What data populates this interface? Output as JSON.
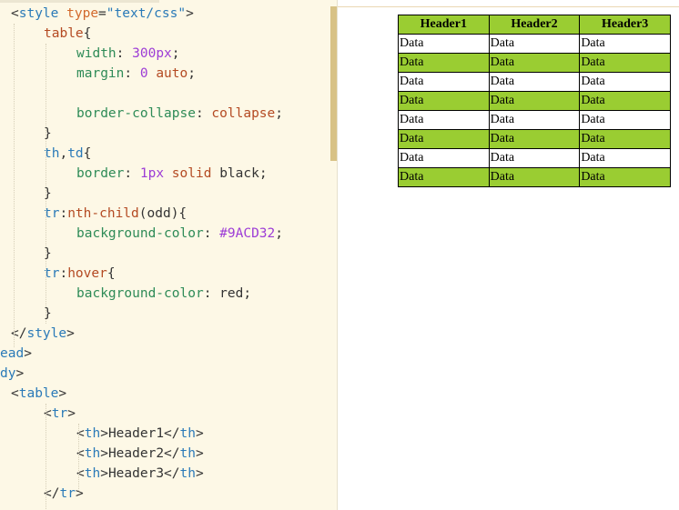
{
  "editor": {
    "lines": [
      [
        {
          "c": "t-punc",
          "t": "<"
        },
        {
          "c": "t-tag",
          "t": "style"
        },
        {
          "c": "t-punc",
          "t": " "
        },
        {
          "c": "t-attr",
          "t": "type"
        },
        {
          "c": "t-punc",
          "t": "="
        },
        {
          "c": "t-str",
          "t": "\"text/css\""
        },
        {
          "c": "t-punc",
          "t": ">"
        }
      ],
      [
        {
          "c": "t-sel",
          "t": "table"
        },
        {
          "c": "t-punc",
          "t": "{"
        }
      ],
      [
        {
          "c": "t-prop",
          "t": "width"
        },
        {
          "c": "t-punc",
          "t": ": "
        },
        {
          "c": "t-num",
          "t": "300px"
        },
        {
          "c": "t-punc",
          "t": ";"
        }
      ],
      [
        {
          "c": "t-prop",
          "t": "margin"
        },
        {
          "c": "t-punc",
          "t": ": "
        },
        {
          "c": "t-num",
          "t": "0"
        },
        {
          "c": "t-punc",
          "t": " "
        },
        {
          "c": "t-val",
          "t": "auto"
        },
        {
          "c": "t-punc",
          "t": ";"
        }
      ],
      [],
      [
        {
          "c": "t-prop",
          "t": "border-collapse"
        },
        {
          "c": "t-punc",
          "t": ": "
        },
        {
          "c": "t-val",
          "t": "collapse"
        },
        {
          "c": "t-punc",
          "t": ";"
        }
      ],
      [
        {
          "c": "t-punc",
          "t": "}"
        }
      ],
      [
        {
          "c": "t-tag",
          "t": "th"
        },
        {
          "c": "t-punc",
          "t": ","
        },
        {
          "c": "t-tag",
          "t": "td"
        },
        {
          "c": "t-punc",
          "t": "{"
        }
      ],
      [
        {
          "c": "t-prop",
          "t": "border"
        },
        {
          "c": "t-punc",
          "t": ": "
        },
        {
          "c": "t-num",
          "t": "1px"
        },
        {
          "c": "t-punc",
          "t": " "
        },
        {
          "c": "t-val",
          "t": "solid"
        },
        {
          "c": "t-punc",
          "t": " "
        },
        {
          "c": "t-text",
          "t": "black"
        },
        {
          "c": "t-punc",
          "t": ";"
        }
      ],
      [
        {
          "c": "t-punc",
          "t": "}"
        }
      ],
      [
        {
          "c": "t-tag",
          "t": "tr"
        },
        {
          "c": "t-punc",
          "t": ":"
        },
        {
          "c": "t-sel",
          "t": "nth-child"
        },
        {
          "c": "t-punc",
          "t": "(odd){"
        }
      ],
      [
        {
          "c": "t-prop",
          "t": "background-color"
        },
        {
          "c": "t-punc",
          "t": ": "
        },
        {
          "c": "t-num",
          "t": "#9ACD32"
        },
        {
          "c": "t-punc",
          "t": ";"
        }
      ],
      [
        {
          "c": "t-punc",
          "t": "}"
        }
      ],
      [
        {
          "c": "t-tag",
          "t": "tr"
        },
        {
          "c": "t-punc",
          "t": ":"
        },
        {
          "c": "t-sel",
          "t": "hover"
        },
        {
          "c": "t-punc",
          "t": "{"
        }
      ],
      [
        {
          "c": "t-prop",
          "t": "background-color"
        },
        {
          "c": "t-punc",
          "t": ": "
        },
        {
          "c": "t-text",
          "t": "red"
        },
        {
          "c": "t-punc",
          "t": ";"
        }
      ],
      [
        {
          "c": "t-punc",
          "t": "}"
        }
      ],
      [
        {
          "c": "t-punc",
          "t": "</"
        },
        {
          "c": "t-tag",
          "t": "style"
        },
        {
          "c": "t-punc",
          "t": ">"
        }
      ],
      [
        {
          "c": "t-tag",
          "t": "ead"
        },
        {
          "c": "t-punc",
          "t": ">"
        }
      ],
      [
        {
          "c": "t-tag",
          "t": "dy"
        },
        {
          "c": "t-punc",
          "t": ">"
        }
      ],
      [
        {
          "c": "t-punc",
          "t": "<"
        },
        {
          "c": "t-tag",
          "t": "table"
        },
        {
          "c": "t-punc",
          "t": ">"
        }
      ],
      [
        {
          "c": "t-punc",
          "t": "<"
        },
        {
          "c": "t-tag",
          "t": "tr"
        },
        {
          "c": "t-punc",
          "t": ">"
        }
      ],
      [
        {
          "c": "t-punc",
          "t": "<"
        },
        {
          "c": "t-tag",
          "t": "th"
        },
        {
          "c": "t-punc",
          "t": ">"
        },
        {
          "c": "t-text",
          "t": "Header1"
        },
        {
          "c": "t-punc",
          "t": "</"
        },
        {
          "c": "t-tag",
          "t": "th"
        },
        {
          "c": "t-punc",
          "t": ">"
        }
      ],
      [
        {
          "c": "t-punc",
          "t": "<"
        },
        {
          "c": "t-tag",
          "t": "th"
        },
        {
          "c": "t-punc",
          "t": ">"
        },
        {
          "c": "t-text",
          "t": "Header2"
        },
        {
          "c": "t-punc",
          "t": "</"
        },
        {
          "c": "t-tag",
          "t": "th"
        },
        {
          "c": "t-punc",
          "t": ">"
        }
      ],
      [
        {
          "c": "t-punc",
          "t": "<"
        },
        {
          "c": "t-tag",
          "t": "th"
        },
        {
          "c": "t-punc",
          "t": ">"
        },
        {
          "c": "t-text",
          "t": "Header3"
        },
        {
          "c": "t-punc",
          "t": "</"
        },
        {
          "c": "t-tag",
          "t": "th"
        },
        {
          "c": "t-punc",
          "t": ">"
        }
      ],
      [
        {
          "c": "t-punc",
          "t": "</"
        },
        {
          "c": "t-tag",
          "t": "tr"
        },
        {
          "c": "t-punc",
          "t": ">"
        }
      ]
    ]
  },
  "preview": {
    "headers": [
      "Header1",
      "Header2",
      "Header3"
    ],
    "rows": [
      [
        "Data",
        "Data",
        "Data"
      ],
      [
        "Data",
        "Data",
        "Data"
      ],
      [
        "Data",
        "Data",
        "Data"
      ],
      [
        "Data",
        "Data",
        "Data"
      ],
      [
        "Data",
        "Data",
        "Data"
      ],
      [
        "Data",
        "Data",
        "Data"
      ],
      [
        "Data",
        "Data",
        "Data"
      ],
      [
        "Data",
        "Data",
        "Data"
      ]
    ],
    "odd_row_color": "#9ACD32"
  }
}
